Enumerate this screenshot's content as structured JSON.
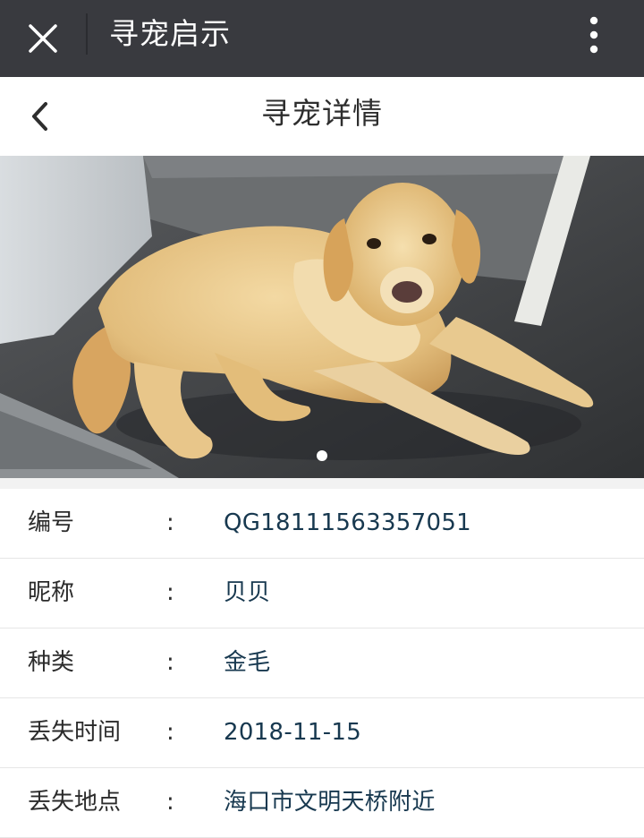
{
  "topbar": {
    "title": "寻宠启示",
    "close_icon": "close-icon",
    "more_icon": "more-vertical-icon"
  },
  "header": {
    "title": "寻宠详情",
    "back_icon": "chevron-left-icon"
  },
  "carousel": {
    "image_description": "golden retriever dog lying on floor",
    "total_slides": 1,
    "active_slide": 1
  },
  "details": [
    {
      "label": "编号",
      "colon": ":",
      "value": "QG18111563357051"
    },
    {
      "label": "昵称",
      "colon": ":",
      "value": "贝贝"
    },
    {
      "label": "种类",
      "colon": ":",
      "value": "金毛"
    },
    {
      "label": "丢失时间",
      "colon": ":",
      "value": "2018-11-15"
    },
    {
      "label": "丢失地点",
      "colon": ":",
      "value": "海口市文明天桥附近"
    }
  ],
  "colors": {
    "topbar_bg": "#393a3f",
    "value_text": "#17384f",
    "label_text": "#2b2b2b"
  }
}
